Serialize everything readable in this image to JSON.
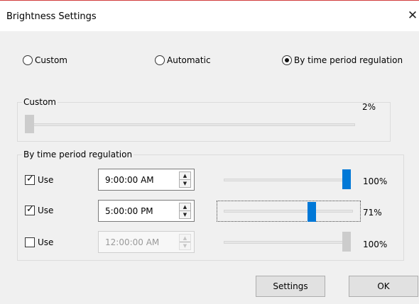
{
  "window": {
    "title": "Brightness Settings",
    "close_glyph": "✕"
  },
  "mode": {
    "options": [
      {
        "label": "Custom",
        "selected": false
      },
      {
        "label": "Automatic",
        "selected": false
      },
      {
        "label": "By time period regulation",
        "selected": true
      }
    ]
  },
  "custom_group": {
    "label": "Custom",
    "value_text": "2%",
    "level": 2
  },
  "time_group": {
    "label": "By time period regulation",
    "rows": [
      {
        "use_label": "Use",
        "checked": true,
        "time": "9:00:00 AM",
        "level_text": "100%",
        "level": 100,
        "enabled": true
      },
      {
        "use_label": "Use",
        "checked": true,
        "time": "5:00:00 PM",
        "level_text": "71%",
        "level": 71,
        "enabled": true
      },
      {
        "use_label": "Use",
        "checked": false,
        "time": "12:00:00 AM",
        "level_text": "100%",
        "level": 100,
        "enabled": false
      }
    ]
  },
  "buttons": {
    "settings": "Settings",
    "ok": "OK"
  },
  "icons": {
    "check": "✓",
    "spin_up": "▲",
    "spin_down": "▼"
  },
  "colors": {
    "accent": "#0078d7",
    "disabled_thumb": "#cccccc"
  }
}
